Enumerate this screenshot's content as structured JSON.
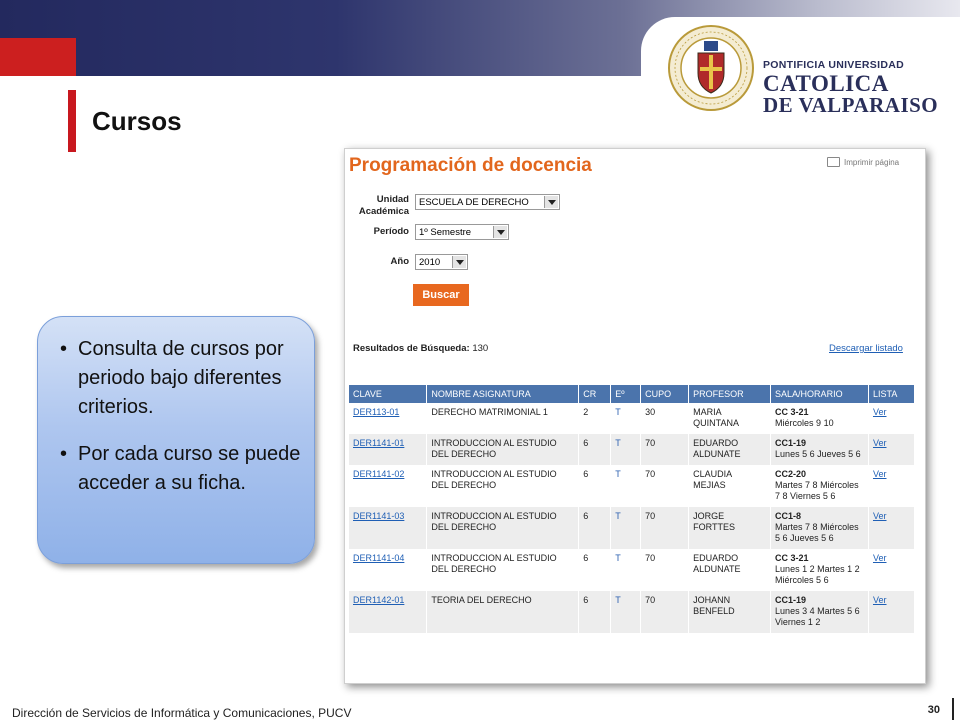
{
  "colors": {
    "accent_red": "#cc1f1f",
    "header_navy": "#23295e",
    "orange": "#e8681f",
    "table_header": "#4b74ac",
    "link": "#1f5fb5"
  },
  "university": {
    "line1": "PONTIFICIA UNIVERSIDAD",
    "line2": "CATOLICA",
    "line3": "DE VALPARAISO",
    "seal_icon": "university-seal-icon"
  },
  "slide": {
    "title": "Cursos",
    "page_number": "30",
    "footer": "Dirección de Servicios de Informática y Comunicaciones, PUCV"
  },
  "callout": {
    "bullets": [
      "Consulta de cursos por periodo bajo diferentes criterios.",
      "Por cada curso se puede acceder a su ficha."
    ]
  },
  "app": {
    "title": "Programación de docencia",
    "print_label": "Imprimir página",
    "form": {
      "unidad_label_1": "Unidad",
      "unidad_label_2": "Académica",
      "unidad_value": "ESCUELA DE DERECHO",
      "periodo_label": "Período",
      "periodo_value": "1º Semestre",
      "anio_label": "Año",
      "anio_value": "2010",
      "search_button": "Buscar"
    },
    "results_label": "Resultados de Búsqueda:",
    "results_count": "130",
    "download_link": "Descargar listado",
    "table": {
      "headers": [
        "CLAVE",
        "NOMBRE ASIGNATURA",
        "CR",
        "Eº",
        "CUPO",
        "PROFESOR",
        "SALA/HORARIO",
        "LISTA"
      ],
      "rows": [
        {
          "clave": "DER113-01",
          "nombre": "DERECHO MATRIMONIAL 1",
          "cr": "2",
          "e": "T",
          "cupo": "30",
          "profesor": "MARIA QUINTANA",
          "sala": "CC 3-21",
          "horario": "Miércoles 9 10",
          "lista": "Ver"
        },
        {
          "clave": "DER1141-01",
          "nombre": "INTRODUCCION AL ESTUDIO DEL DERECHO",
          "cr": "6",
          "e": "T",
          "cupo": "70",
          "profesor": "EDUARDO ALDUNATE",
          "sala": "CC1-19",
          "horario": "Lunes 5 6 Jueves 5 6",
          "lista": "Ver"
        },
        {
          "clave": "DER1141-02",
          "nombre": "INTRODUCCION AL ESTUDIO DEL DERECHO",
          "cr": "6",
          "e": "T",
          "cupo": "70",
          "profesor": "CLAUDIA MEJIAS",
          "sala": "CC2-20",
          "horario": "Martes 7 8 Miércoles 7 8 Viernes 5 6",
          "lista": "Ver"
        },
        {
          "clave": "DER1141-03",
          "nombre": "INTRODUCCION AL ESTUDIO DEL DERECHO",
          "cr": "6",
          "e": "T",
          "cupo": "70",
          "profesor": "JORGE FORTTES",
          "sala": "CC1-8",
          "horario": "Martes 7 8 Miércoles 5 6 Jueves 5 6",
          "lista": "Ver"
        },
        {
          "clave": "DER1141-04",
          "nombre": "INTRODUCCION AL ESTUDIO DEL DERECHO",
          "cr": "6",
          "e": "T",
          "cupo": "70",
          "profesor": "EDUARDO ALDUNATE",
          "sala": "CC 3-21",
          "horario": "Lunes 1 2 Martes 1 2 Miércoles 5 6",
          "lista": "Ver"
        },
        {
          "clave": "DER1142-01",
          "nombre": "TEORIA DEL DERECHO",
          "cr": "6",
          "e": "T",
          "cupo": "70",
          "profesor": "JOHANN BENFELD",
          "sala": "CC1-19",
          "horario": "Lunes 3 4 Martes 5 6 Viernes 1 2",
          "lista": "Ver"
        }
      ]
    }
  }
}
